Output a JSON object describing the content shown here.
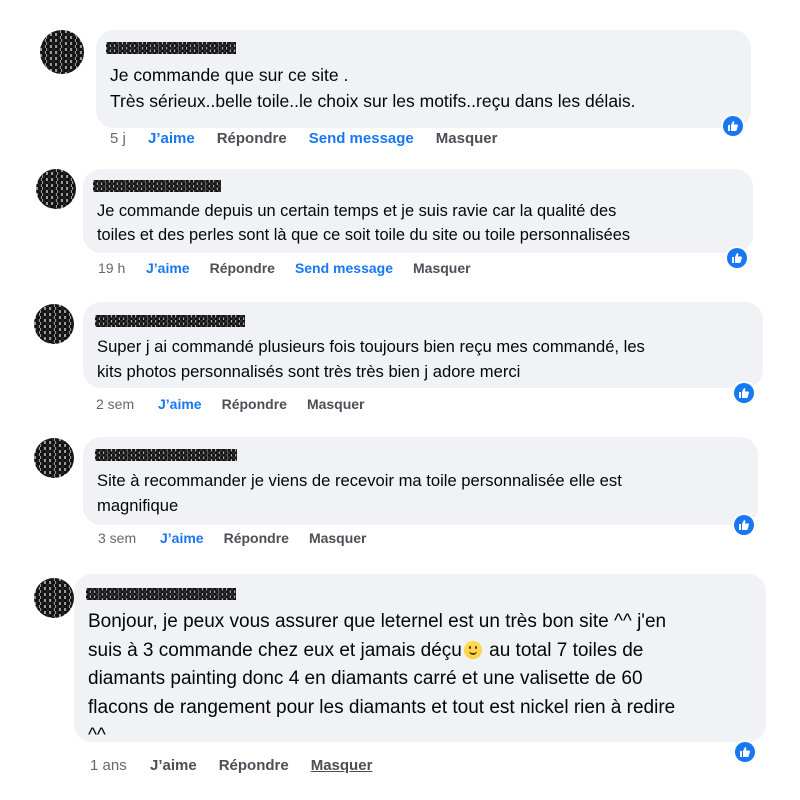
{
  "comments": [
    {
      "text": "Je commande que sur ce site .\nTrès sérieux..belle toile..le choix sur les motifs..reçu dans les délais.",
      "time": "5 j",
      "like": "J’aime",
      "reply": "Répondre",
      "send": "Send message",
      "hide": "Masquer"
    },
    {
      "text": "Je commande depuis un certain temps et je suis ravie car la qualité des\ntoiles et des perles sont là que ce soit toile du site ou toile personnalisées",
      "time": "19 h",
      "like": "J’aime",
      "reply": "Répondre",
      "send": "Send message",
      "hide": "Masquer"
    },
    {
      "text": "Super j ai commandé plusieurs fois toujours bien reçu mes commandé, les\nkits photos personnalisés sont très très bien j adore merci",
      "time": "2 sem",
      "like": "J’aime",
      "reply": "Répondre",
      "hide": "Masquer"
    },
    {
      "text": "Site à recommander je viens de recevoir ma toile personnalisée elle est\nmagnifique",
      "time": "3 sem",
      "like": "J’aime",
      "reply": "Répondre",
      "hide": "Masquer"
    },
    {
      "text_a": "Bonjour, je peux vous assurer que leternel est un très bon site ^^ j'en\nsuis à 3 commande chez eux et jamais déçu",
      "text_b": " au total 7 toiles de\ndiamants painting donc 4 en diamants carré et une valisette de 60\nflacons de rangement pour les diamants et tout est nickel rien à redire\n^^",
      "emoji": "smiling-face-emoji",
      "time": "1 ans",
      "like": "J’aime",
      "reply": "Répondre",
      "hide": "Masquer"
    }
  ],
  "colors": {
    "bubble": "#f0f2f5",
    "link_blue": "#1877f2",
    "meta_gray": "#65676b"
  },
  "icons": {
    "reaction": "thumbs-up-icon"
  }
}
